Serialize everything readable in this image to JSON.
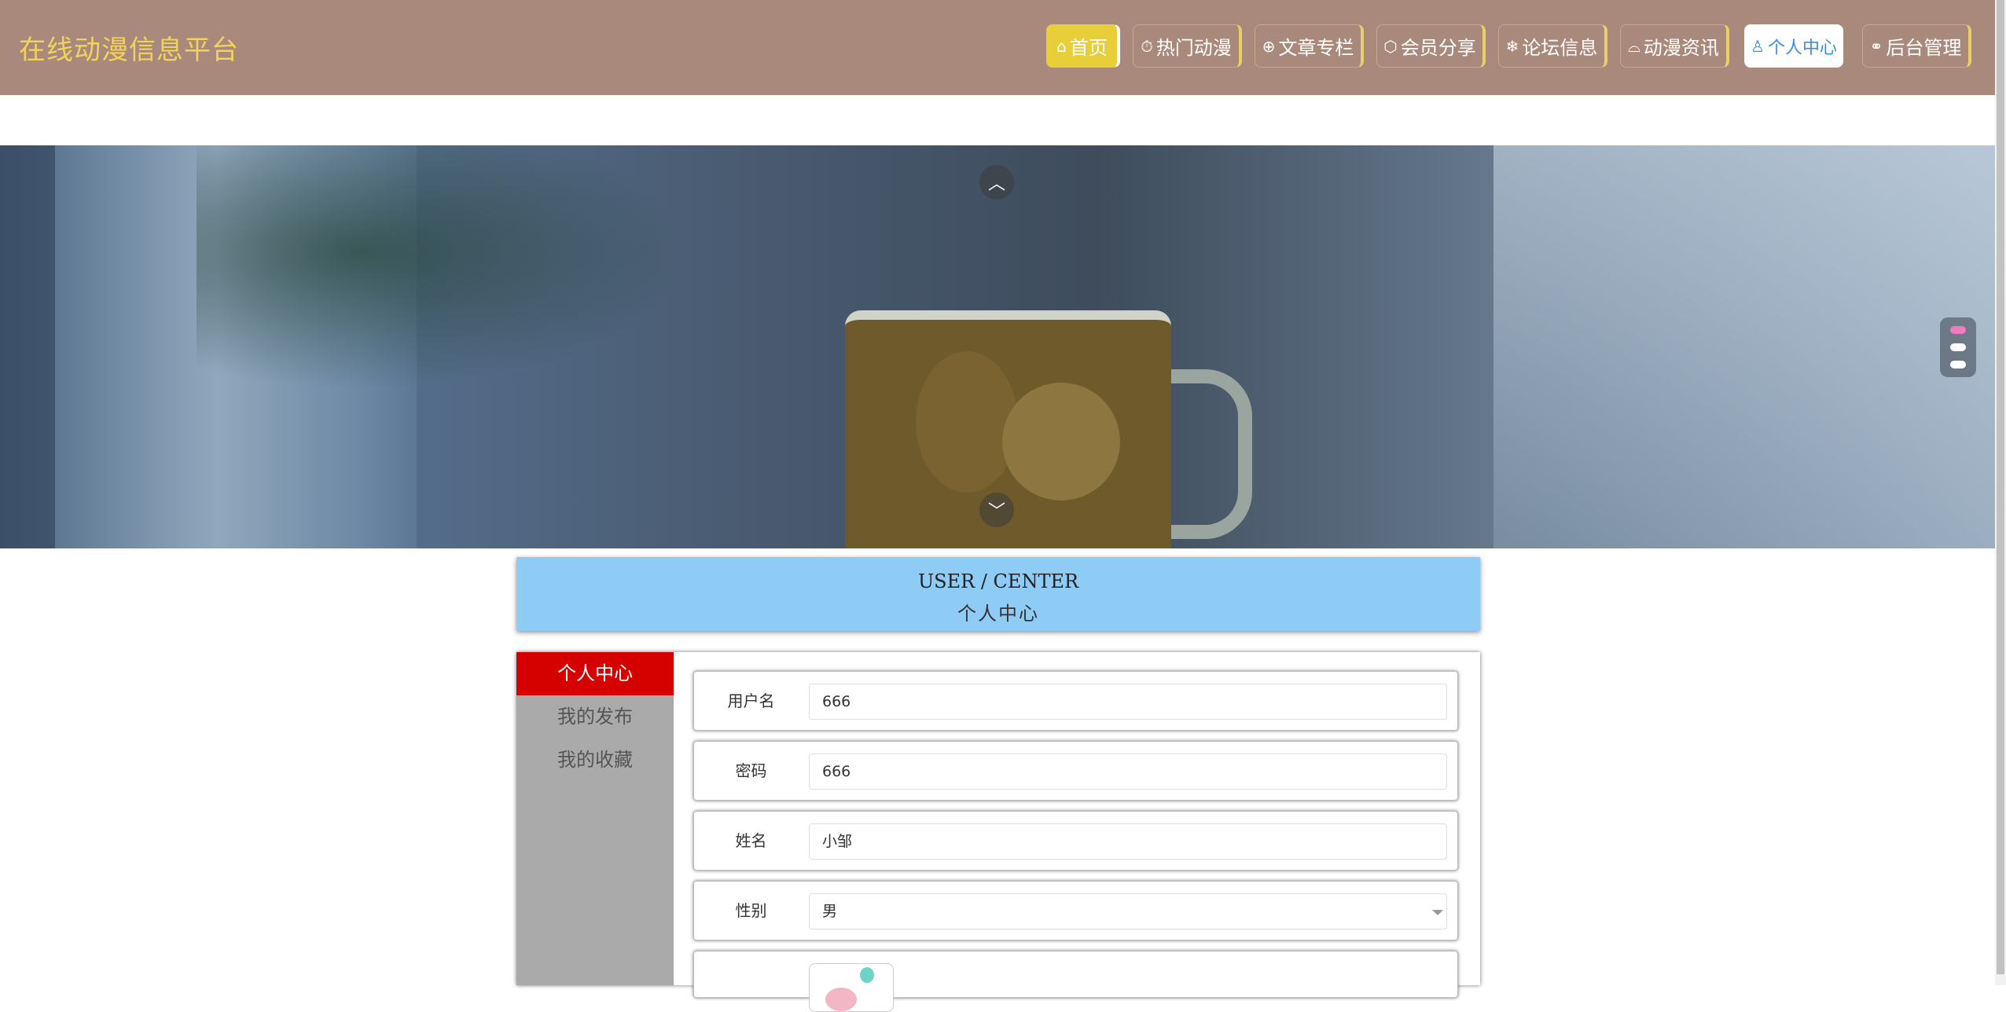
{
  "brand": "在线动漫信息平台",
  "nav": [
    {
      "icon": "⌂",
      "label": "首页"
    },
    {
      "icon": "⏱",
      "label": "热门动漫"
    },
    {
      "icon": "⊕",
      "label": "文章专栏"
    },
    {
      "icon": "⬡",
      "label": "会员分享"
    },
    {
      "icon": "❄",
      "label": "论坛信息"
    },
    {
      "icon": "⌓",
      "label": "动漫资讯"
    },
    {
      "icon": "♙",
      "label": "个人中心"
    },
    {
      "icon": "⚭",
      "label": "后台管理"
    }
  ],
  "carousel": {
    "prev": "︿",
    "next": "﹀",
    "slides": 3,
    "current": 1
  },
  "user_center": {
    "title_en": "USER / CENTER",
    "title_zh": "个人中心"
  },
  "side_menu": [
    "个人中心",
    "我的发布",
    "我的收藏"
  ],
  "form": {
    "username": {
      "label": "用户名",
      "value": "666"
    },
    "password": {
      "label": "密码",
      "value": "666"
    },
    "name": {
      "label": "姓名",
      "value": "小邹"
    },
    "gender": {
      "label": "性别",
      "value": "男"
    }
  },
  "colors": {
    "header_bg": "#a9897c",
    "brand_text": "#f2d35a",
    "home_btn": "#e8cf3a",
    "active_nav_text": "#3a8ee6",
    "title_banner": "#8ecbf5",
    "side_active": "#d50000"
  }
}
